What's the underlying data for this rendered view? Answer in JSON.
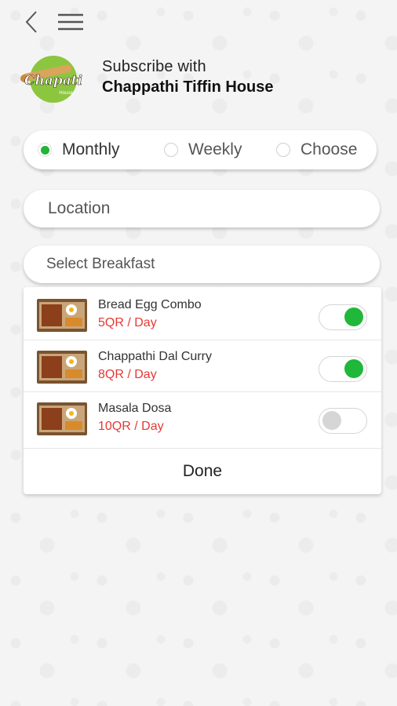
{
  "header": {
    "logo_text": "Chapati",
    "logo_subtext": "House",
    "subscribe_line": "Subscribe with",
    "vendor_name": "Chappathi Tiffin House"
  },
  "plans": {
    "options": [
      {
        "label": "Monthly",
        "selected": true
      },
      {
        "label": "Weekly",
        "selected": false
      },
      {
        "label": "Choose",
        "selected": false
      }
    ]
  },
  "location": {
    "placeholder": "Location"
  },
  "breakfast": {
    "placeholder": "Select Breakfast"
  },
  "items": [
    {
      "name": "Bread Egg Combo",
      "price": "5QR / Day",
      "enabled": true
    },
    {
      "name": "Chappathi Dal Curry",
      "price": "8QR / Day",
      "enabled": true
    },
    {
      "name": "Masala Dosa",
      "price": "10QR / Day",
      "enabled": false
    }
  ],
  "done_label": "Done",
  "colors": {
    "accent_green": "#1fb83a",
    "price_red": "#e53935",
    "logo_green": "#8cc63f"
  },
  "icons": {
    "back": "chevron-left-icon",
    "menu": "hamburger-menu-icon"
  }
}
